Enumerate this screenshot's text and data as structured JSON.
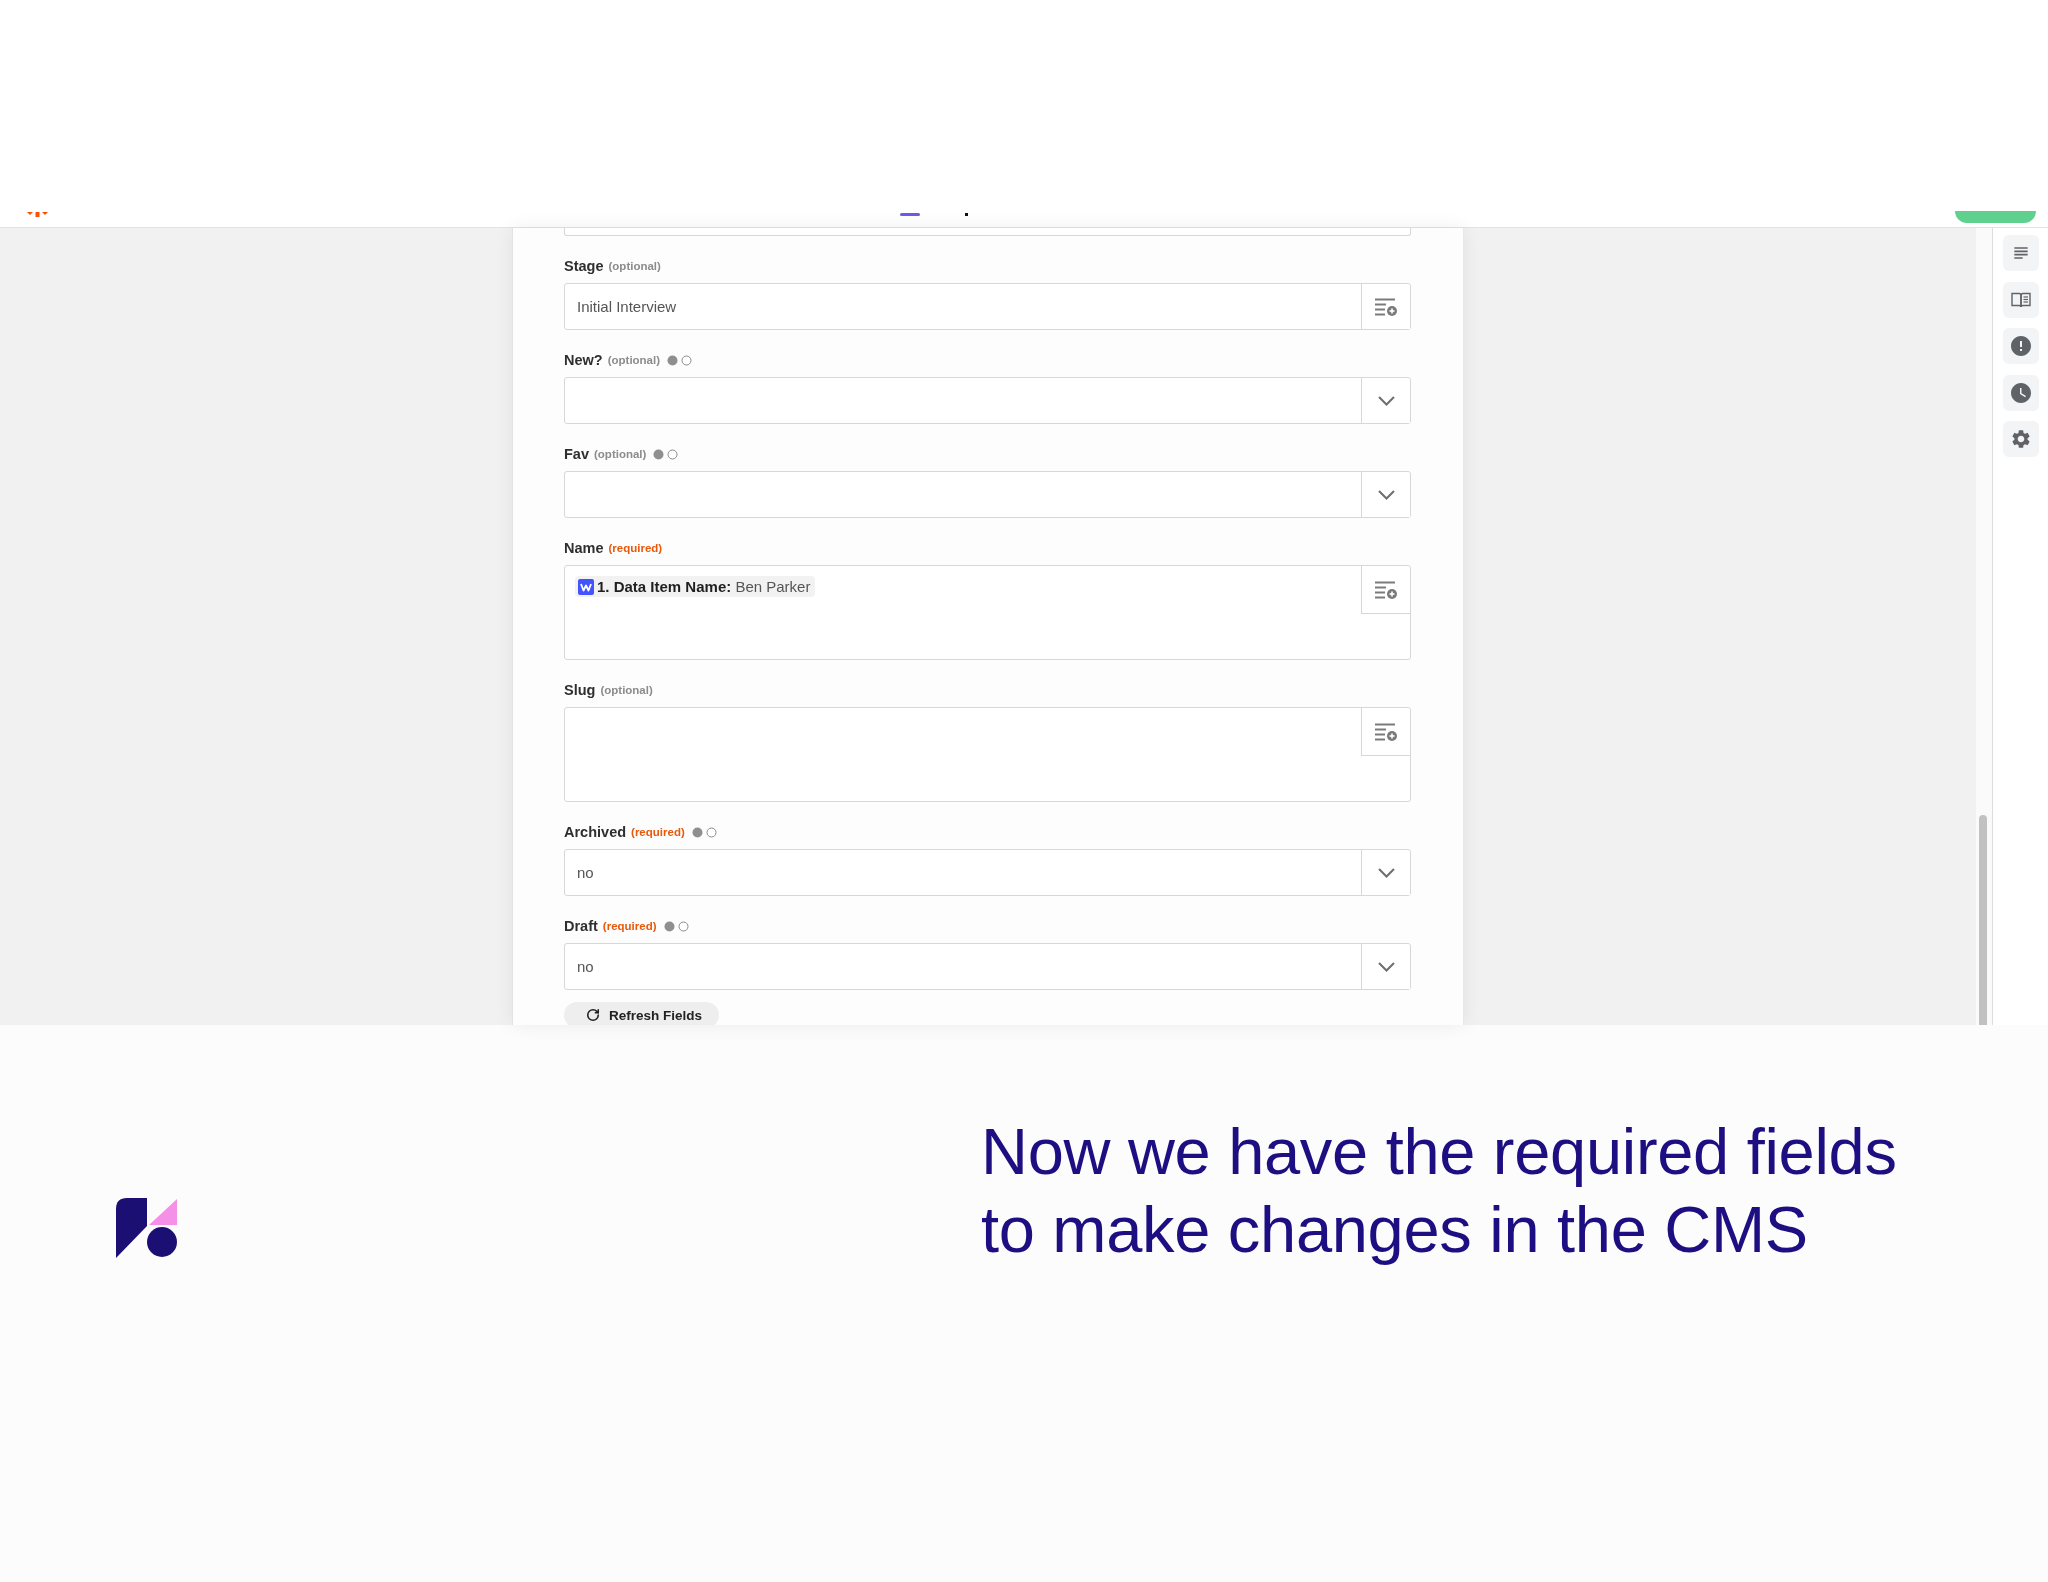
{
  "form": {
    "fields": [
      {
        "kind": "text",
        "label": "Stage",
        "note": "(optional)",
        "required": false,
        "value": "Initial Interview"
      },
      {
        "kind": "dropdown",
        "label": "New?",
        "note": "(optional)",
        "required": false,
        "toggle": [
          {
            "selected": true
          },
          {
            "selected": false
          }
        ]
      },
      {
        "kind": "dropdown",
        "label": "Fav",
        "note": "(optional)",
        "required": false,
        "toggle": [
          {
            "selected": true
          },
          {
            "selected": false
          }
        ]
      },
      {
        "kind": "textarea",
        "label": "Name",
        "note": "(required)",
        "required": true,
        "token": "**1. Data Item Name:** Ben Parker"
      },
      {
        "kind": "textarea",
        "label": "Slug",
        "note": "(optional)",
        "required": false
      },
      {
        "kind": "dropdown",
        "label": "Archived",
        "note": "(required)",
        "required": true,
        "value": "no",
        "toggle": [
          {
            "selected": true
          },
          {
            "selected": false
          }
        ]
      },
      {
        "kind": "dropdown",
        "label": "Draft",
        "note": "(required)",
        "required": true,
        "value": "no",
        "toggle": [
          {
            "selected": true
          },
          {
            "selected": false
          }
        ]
      }
    ],
    "refresh_button": {
      "label": "Refresh Fields"
    }
  },
  "caption": {
    "text": "Now we have the required fields to make changes in the CMS"
  }
}
